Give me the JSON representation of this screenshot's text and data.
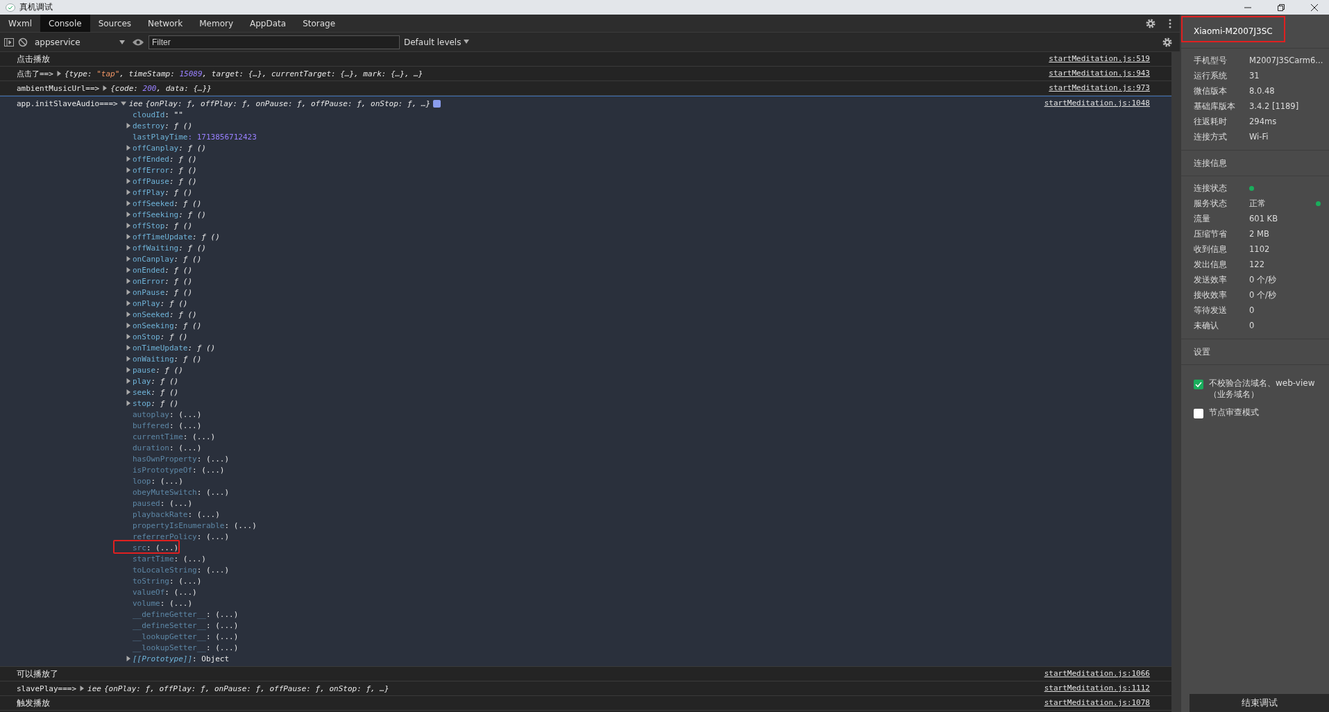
{
  "window": {
    "title": "真机调试"
  },
  "tabs": [
    {
      "label": "Wxml",
      "selected": false
    },
    {
      "label": "Console",
      "selected": true
    },
    {
      "label": "Sources",
      "selected": false
    },
    {
      "label": "Network",
      "selected": false
    },
    {
      "label": "Memory",
      "selected": false
    },
    {
      "label": "AppData",
      "selected": false
    },
    {
      "label": "Storage",
      "selected": false
    }
  ],
  "toolbar": {
    "context": "appservice",
    "filter": {
      "placeholder": "Filter"
    },
    "levels": "Default levels"
  },
  "console": [
    {
      "kind": "text",
      "message": "点击播放",
      "source": "startMeditation.js:519"
    },
    {
      "kind": "object",
      "label": "点击了==>",
      "expanded": false,
      "preview": [
        {
          "kind": "plain",
          "text": "{type: "
        },
        {
          "kind": "string",
          "text": "\"tap\""
        },
        {
          "kind": "plain",
          "text": ", timeStamp: "
        },
        {
          "kind": "number",
          "text": "15089"
        },
        {
          "kind": "plain",
          "text": ", target: {…}, currentTarget: {…}, mark: {…}, …}"
        }
      ],
      "source": "startMeditation.js:943"
    },
    {
      "kind": "object",
      "label": "ambientMusicUrl==>",
      "expanded": false,
      "preview": [
        {
          "kind": "plain",
          "text": "{code: "
        },
        {
          "kind": "number",
          "text": "200"
        },
        {
          "kind": "plain",
          "text": ", data: {…}}"
        }
      ],
      "source": "startMeditation.js:973"
    },
    {
      "kind": "object",
      "label": "app.initSlaveAudio===>",
      "expanded": true,
      "class_name": "iee",
      "preview": [
        {
          "kind": "plain",
          "text": "{onPlay: ƒ, offPlay: ƒ, onPause: ƒ, offPause: ƒ, onStop: ƒ, …}"
        }
      ],
      "source": "startMeditation.js:1048",
      "properties": [
        {
          "kind": "string",
          "name": "cloudId",
          "value": ": \"\""
        },
        {
          "kind": "function",
          "name": "destroy",
          "value": ": ƒ ()"
        },
        {
          "kind": "number",
          "name": "lastPlayTime",
          "value": ": 1713856712423"
        },
        {
          "kind": "function",
          "name": "offCanplay",
          "value": ": ƒ ()"
        },
        {
          "kind": "function",
          "name": "offEnded",
          "value": ": ƒ ()"
        },
        {
          "kind": "function",
          "name": "offError",
          "value": ": ƒ ()"
        },
        {
          "kind": "function",
          "name": "offPause",
          "value": ": ƒ ()"
        },
        {
          "kind": "function",
          "name": "offPlay",
          "value": ": ƒ ()"
        },
        {
          "kind": "function",
          "name": "offSeeked",
          "value": ": ƒ ()"
        },
        {
          "kind": "function",
          "name": "offSeeking",
          "value": ": ƒ ()"
        },
        {
          "kind": "function",
          "name": "offStop",
          "value": ": ƒ ()"
        },
        {
          "kind": "function",
          "name": "offTimeUpdate",
          "value": ": ƒ ()"
        },
        {
          "kind": "function",
          "name": "offWaiting",
          "value": ": ƒ ()"
        },
        {
          "kind": "function",
          "name": "onCanplay",
          "value": ": ƒ ()"
        },
        {
          "kind": "function",
          "name": "onEnded",
          "value": ": ƒ ()"
        },
        {
          "kind": "function",
          "name": "onError",
          "value": ": ƒ ()"
        },
        {
          "kind": "function",
          "name": "onPause",
          "value": ": ƒ ()"
        },
        {
          "kind": "function",
          "name": "onPlay",
          "value": ": ƒ ()"
        },
        {
          "kind": "function",
          "name": "onSeeked",
          "value": ": ƒ ()"
        },
        {
          "kind": "function",
          "name": "onSeeking",
          "value": ": ƒ ()"
        },
        {
          "kind": "function",
          "name": "onStop",
          "value": ": ƒ ()"
        },
        {
          "kind": "function",
          "name": "onTimeUpdate",
          "value": ": ƒ ()"
        },
        {
          "kind": "function",
          "name": "onWaiting",
          "value": ": ƒ ()"
        },
        {
          "kind": "function",
          "name": "pause",
          "value": ": ƒ ()"
        },
        {
          "kind": "function",
          "name": "play",
          "value": ": ƒ ()"
        },
        {
          "kind": "function",
          "name": "seek",
          "value": ": ƒ ()"
        },
        {
          "kind": "function",
          "name": "stop",
          "value": ": ƒ ()"
        },
        {
          "kind": "accessor",
          "name": "autoplay",
          "value": ": (...)"
        },
        {
          "kind": "accessor",
          "name": "buffered",
          "value": ": (...)"
        },
        {
          "kind": "accessor",
          "name": "currentTime",
          "value": ": (...)"
        },
        {
          "kind": "accessor",
          "name": "duration",
          "value": ": (...)"
        },
        {
          "kind": "accessor",
          "name": "hasOwnProperty",
          "value": ": (...)"
        },
        {
          "kind": "accessor",
          "name": "isPrototypeOf",
          "value": ": (...)"
        },
        {
          "kind": "accessor",
          "name": "loop",
          "value": ": (...)"
        },
        {
          "kind": "accessor",
          "name": "obeyMuteSwitch",
          "value": ": (...)"
        },
        {
          "kind": "accessor",
          "name": "paused",
          "value": ": (...)"
        },
        {
          "kind": "accessor",
          "name": "playbackRate",
          "value": ": (...)"
        },
        {
          "kind": "accessor",
          "name": "propertyIsEnumerable",
          "value": ": (...)"
        },
        {
          "kind": "accessor",
          "name": "referrerPolicy",
          "value": ": (...)"
        },
        {
          "kind": "accessor",
          "name": "src",
          "value": ": (...)",
          "highlighted": true
        },
        {
          "kind": "accessor",
          "name": "startTime",
          "value": ": (...)"
        },
        {
          "kind": "accessor",
          "name": "toLocaleString",
          "value": ": (...)"
        },
        {
          "kind": "accessor",
          "name": "toString",
          "value": ": (...)"
        },
        {
          "kind": "accessor",
          "name": "valueOf",
          "value": ": (...)"
        },
        {
          "kind": "accessor",
          "name": "volume",
          "value": ": (...)"
        },
        {
          "kind": "accessor",
          "name": "__defineGetter__",
          "value": ": (...)"
        },
        {
          "kind": "accessor",
          "name": "__defineSetter__",
          "value": ": (...)"
        },
        {
          "kind": "accessor",
          "name": "__lookupGetter__",
          "value": ": (...)"
        },
        {
          "kind": "accessor",
          "name": "__lookupSetter__",
          "value": ": (...)"
        },
        {
          "kind": "prototype",
          "name": "[[Prototype]]",
          "value": ": Object"
        }
      ]
    },
    {
      "kind": "text",
      "message": "可以播放了",
      "source": "startMeditation.js:1066"
    },
    {
      "kind": "object",
      "label": "slavePlay===>",
      "expanded": false,
      "class_name": "iee",
      "preview": [
        {
          "kind": "plain",
          "text": "{onPlay: ƒ, offPlay: ƒ, onPause: ƒ, offPause: ƒ, onStop: ƒ, …}"
        }
      ],
      "source": "startMeditation.js:1112"
    },
    {
      "kind": "text",
      "message": "触发播放",
      "source": "startMeditation.js:1078"
    }
  ],
  "sidebar": {
    "device": {
      "name": "Xiaomi-M2007J3SC",
      "highlighted": true
    },
    "info": [
      {
        "label": "手机型号",
        "value": "M2007J3SCarm6..."
      },
      {
        "label": "运行系统",
        "value": "31"
      },
      {
        "label": "微信版本",
        "value": "8.0.48"
      },
      {
        "label": "基础库版本",
        "value": "3.4.2 [1189]"
      },
      {
        "label": "往返耗时",
        "value": "294ms"
      },
      {
        "label": "连接方式",
        "value": "Wi-Fi"
      }
    ],
    "connection_title": "连接信息",
    "connection": [
      {
        "kind": "dot",
        "label": "连接状态",
        "color": "#1aad5c"
      },
      {
        "kind": "text_dot",
        "label": "服务状态",
        "value": "正常",
        "color": "#1aad5c"
      },
      {
        "kind": "text",
        "label": "流量",
        "value": "601 KB"
      },
      {
        "kind": "text",
        "label": "压缩节省",
        "value": "2 MB"
      },
      {
        "kind": "text",
        "label": "收到信息",
        "value": "1102"
      },
      {
        "kind": "text",
        "label": "发出信息",
        "value": "122"
      },
      {
        "kind": "text",
        "label": "发送效率",
        "value": "0 个/秒"
      },
      {
        "kind": "text",
        "label": "接收效率",
        "value": "0 个/秒"
      },
      {
        "kind": "text",
        "label": "等待发送",
        "value": "0"
      },
      {
        "kind": "text",
        "label": "未确认",
        "value": "0"
      }
    ],
    "settings_title": "设置",
    "settings": [
      {
        "label": "不校验合法域名、web-view（业务域名）",
        "checked": true
      },
      {
        "label": "节点审查模式",
        "checked": false
      }
    ],
    "end_button": "结束调试"
  }
}
